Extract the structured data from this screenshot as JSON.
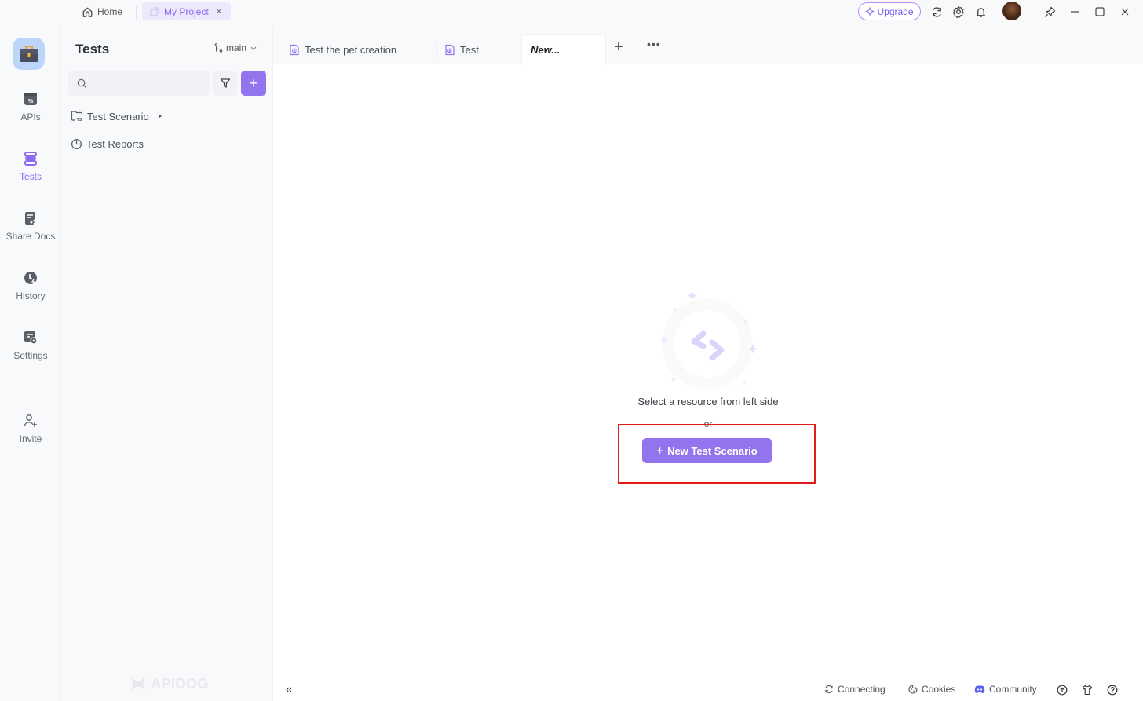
{
  "titlebar": {
    "home_label": "Home",
    "project_tab_label": "My Project",
    "project_tab_close": "×",
    "upgrade_label": "Upgrade",
    "icons": [
      "refresh-icon",
      "gear-icon",
      "bell-icon",
      "avatar",
      "pin-icon",
      "minimize-icon",
      "maximize-icon",
      "close-icon"
    ],
    "window_close": "✕"
  },
  "rail": {
    "items": [
      {
        "label": "APIs",
        "icon": "apis-icon",
        "active": false
      },
      {
        "label": "Tests",
        "icon": "tests-icon",
        "active": true
      },
      {
        "label": "Share Docs",
        "icon": "share-docs-icon",
        "active": false
      },
      {
        "label": "History",
        "icon": "history-icon",
        "active": false
      },
      {
        "label": "Settings",
        "icon": "settings-icon",
        "active": false
      },
      {
        "label": "Invite",
        "icon": "invite-icon",
        "active": false
      }
    ]
  },
  "sidebar": {
    "title": "Tests",
    "branch": "main",
    "search": {
      "value": "",
      "placeholder": ""
    },
    "add_label": "+",
    "tree": [
      {
        "label": "Test Scenario",
        "icon": "folder-ts-icon",
        "has_arrow": true
      },
      {
        "label": "Test Reports",
        "icon": "pie-chart-icon",
        "has_arrow": false
      }
    ],
    "watermark": "APIDOG"
  },
  "tabs": {
    "items": [
      {
        "label": "Test the pet creation",
        "active": false
      },
      {
        "label": "Test",
        "active": false
      },
      {
        "label": "New...",
        "active": true
      }
    ],
    "add_label": "+",
    "more_label": "•••"
  },
  "empty_state": {
    "message": "Select a resource from left side",
    "or_text": "or",
    "button_label": "New Test Scenario",
    "button_prefix": "+"
  },
  "statusbar": {
    "collapse_label": "«",
    "connecting_label": "Connecting",
    "cookies_label": "Cookies",
    "community_label": "Community"
  },
  "colors": {
    "accent": "#9373ee",
    "highlight": "#e01b1b"
  }
}
